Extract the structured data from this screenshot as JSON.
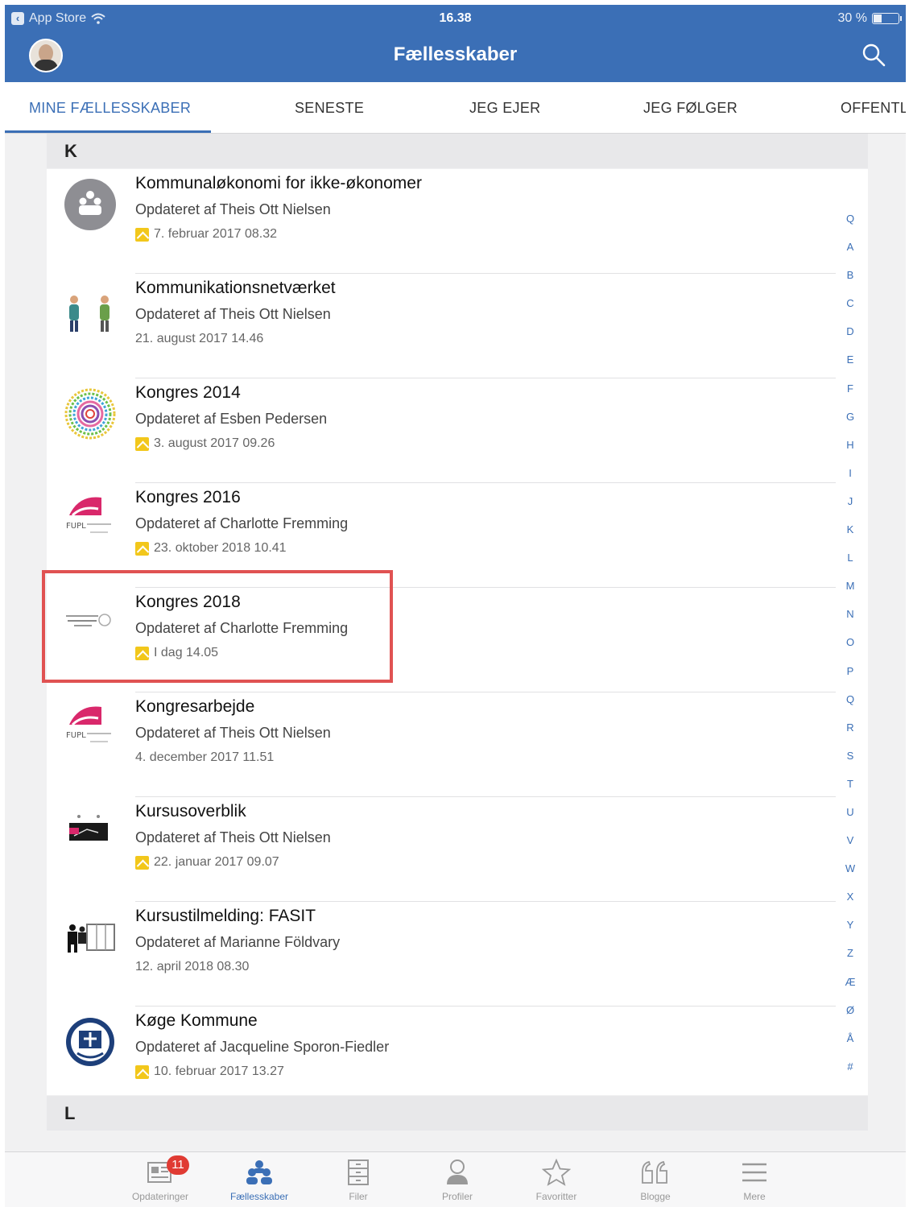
{
  "status_bar": {
    "back_app": "App Store",
    "time": "16.38",
    "battery": "30 %"
  },
  "header": {
    "title": "Fællesskaber"
  },
  "tabs": [
    {
      "label": "MINE FÆLLESSKABER",
      "active": true
    },
    {
      "label": "SENESTE",
      "active": false
    },
    {
      "label": "JEG EJER",
      "active": false
    },
    {
      "label": "JEG FØLGER",
      "active": false
    },
    {
      "label": "OFFENTL",
      "active": false
    }
  ],
  "sections": [
    {
      "letter": "K"
    },
    {
      "letter": "L"
    }
  ],
  "communities": [
    {
      "name": "Kommunaløkonomi for ikke-økonomer",
      "updated_by": "Opdateret af Theis Ott Nielsen",
      "date": "7. februar 2017 08.32",
      "flag": true,
      "icon": "group-placeholder"
    },
    {
      "name": "Kommunikationsnetværket",
      "updated_by": "Opdateret af Theis Ott Nielsen",
      "date": "21. august 2017 14.46",
      "flag": false,
      "icon": "people-figures"
    },
    {
      "name": "Kongres 2014",
      "updated_by": "Opdateret af Esben Pedersen",
      "date": "3. august 2017 09.26",
      "flag": true,
      "icon": "concentric-circles"
    },
    {
      "name": "Kongres 2016",
      "updated_by": "Opdateret af Charlotte Fremming",
      "date": "23. oktober 2018 10.41",
      "flag": true,
      "icon": "fupl-logo"
    },
    {
      "name": "Kongres 2018",
      "updated_by": "Opdateret af Charlotte Fremming",
      "date": "I dag 14.05",
      "flag": true,
      "icon": "kongres-logo"
    },
    {
      "name": "Kongresarbejde",
      "updated_by": "Opdateret af Theis Ott Nielsen",
      "date": "4. december 2017 11.51",
      "flag": false,
      "icon": "fupl-logo"
    },
    {
      "name": "Kursusoverblik",
      "updated_by": "Opdateret af Theis Ott Nielsen",
      "date": "22. januar 2017 09.07",
      "flag": true,
      "icon": "blackboard"
    },
    {
      "name": "Kursustilmelding: FASIT",
      "updated_by": "Opdateret af Marianne Földvary",
      "date": "12. april 2018 08.30",
      "flag": false,
      "icon": "classroom"
    },
    {
      "name": "Køge Kommune",
      "updated_by": "Opdateret af Jacqueline Sporon-Fiedler",
      "date": "10. februar 2017 13.27",
      "flag": true,
      "icon": "koge-crest"
    }
  ],
  "index_letters": [
    "Q",
    "A",
    "B",
    "C",
    "D",
    "E",
    "F",
    "G",
    "H",
    "I",
    "J",
    "K",
    "L",
    "M",
    "N",
    "O",
    "P",
    "Q",
    "R",
    "S",
    "T",
    "U",
    "V",
    "W",
    "X",
    "Y",
    "Z",
    "Æ",
    "Ø",
    "Å",
    "#"
  ],
  "tabbar": [
    {
      "label": "Opdateringer",
      "badge": "11",
      "active": false,
      "icon": "news-icon"
    },
    {
      "label": "Fællesskaber",
      "active": true,
      "icon": "groups-icon"
    },
    {
      "label": "Filer",
      "active": false,
      "icon": "files-icon"
    },
    {
      "label": "Profiler",
      "active": false,
      "icon": "profile-icon"
    },
    {
      "label": "Favoritter",
      "active": false,
      "icon": "star-icon"
    },
    {
      "label": "Blogge",
      "active": false,
      "icon": "quote-icon"
    },
    {
      "label": "Mere",
      "active": false,
      "icon": "menu-icon"
    }
  ],
  "colors": {
    "brand": "#3b6fb6",
    "highlight": "#e05252",
    "flag": "#f2c71b",
    "badge": "#e03b33"
  }
}
